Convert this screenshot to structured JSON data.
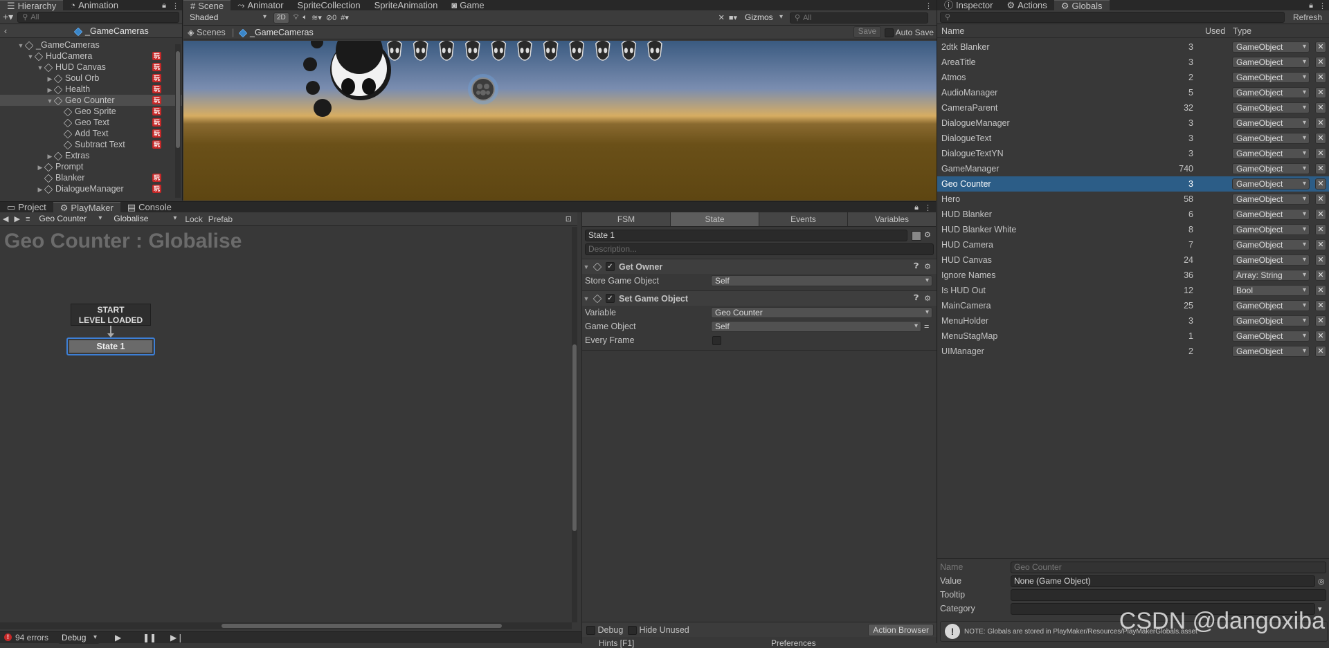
{
  "hierarchy": {
    "tabs": [
      "Hierarchy",
      "Animation"
    ],
    "search_placeholder": "All",
    "back_label": "_GameCameras",
    "items": [
      {
        "label": "_GameCameras",
        "depth": 0,
        "expanded": true,
        "pm": false
      },
      {
        "label": "HudCamera",
        "depth": 1,
        "expanded": true,
        "pm": true
      },
      {
        "label": "HUD Canvas",
        "depth": 2,
        "expanded": true,
        "pm": true
      },
      {
        "label": "Soul Orb",
        "depth": 3,
        "expanded": false,
        "pm": true
      },
      {
        "label": "Health",
        "depth": 3,
        "expanded": false,
        "pm": true
      },
      {
        "label": "Geo Counter",
        "depth": 3,
        "expanded": true,
        "pm": true,
        "selected": true
      },
      {
        "label": "Geo Sprite",
        "depth": 4,
        "expanded": null,
        "pm": true
      },
      {
        "label": "Geo Text",
        "depth": 4,
        "expanded": null,
        "pm": true
      },
      {
        "label": "Add Text",
        "depth": 4,
        "expanded": null,
        "pm": true
      },
      {
        "label": "Subtract Text",
        "depth": 4,
        "expanded": null,
        "pm": true
      },
      {
        "label": "Extras",
        "depth": 3,
        "expanded": false,
        "pm": false
      },
      {
        "label": "Prompt",
        "depth": 2,
        "expanded": false,
        "pm": false
      },
      {
        "label": "Blanker",
        "depth": 2,
        "expanded": null,
        "pm": true
      },
      {
        "label": "DialogueManager",
        "depth": 2,
        "expanded": false,
        "pm": true
      }
    ],
    "pm_badge": "玩"
  },
  "scene": {
    "tabs": [
      "Scene",
      "Animator",
      "SpriteCollection",
      "SpriteAnimation",
      "Game"
    ],
    "shading": "Shaded",
    "mode_2d": "2D",
    "fx_count": "0",
    "gizmos": "Gizmos",
    "search_placeholder": "All",
    "breadcrumb_scenes": "Scenes",
    "breadcrumb_prefab": "_GameCameras",
    "save_label": "Save",
    "autosave_label": "Auto Save"
  },
  "playmaker": {
    "tabs": [
      "Project",
      "PlayMaker",
      "Console"
    ],
    "fsm_target": "Geo Counter",
    "fsm_name": "Globalise",
    "lock_label": "Lock",
    "prefab_label": "Prefab",
    "graph_title": "Geo Counter : Globalise",
    "start_line1": "START",
    "start_line2": "LEVEL LOADED",
    "state_label": "State 1",
    "inspector_tabs": [
      "FSM",
      "State",
      "Events",
      "Variables"
    ],
    "state_name": "State 1",
    "description_placeholder": "Description...",
    "actions": [
      {
        "title": "Get Owner",
        "props": [
          {
            "label": "Store Game Object",
            "value": "Self"
          }
        ]
      },
      {
        "title": "Set Game Object",
        "props": [
          {
            "label": "Variable",
            "value": "Geo Counter"
          },
          {
            "label": "Game Object",
            "value": "Self"
          },
          {
            "label": "Every Frame",
            "value": ""
          }
        ]
      }
    ],
    "debug_label": "Debug",
    "hide_unused_label": "Hide Unused",
    "action_browser_label": "Action Browser",
    "hints_label": "Hints [F1]",
    "preferences_label": "Preferences"
  },
  "status": {
    "errors": "94 errors",
    "debug_mode": "Debug"
  },
  "globals": {
    "tabs": [
      "Inspector",
      "Actions",
      "Globals"
    ],
    "refresh_label": "Refresh",
    "columns": [
      "Name",
      "Used",
      "Type"
    ],
    "rows": [
      {
        "name": "2dtk Blanker",
        "used": "3",
        "type": "GameObject"
      },
      {
        "name": "AreaTitle",
        "used": "3",
        "type": "GameObject"
      },
      {
        "name": "Atmos",
        "used": "2",
        "type": "GameObject"
      },
      {
        "name": "AudioManager",
        "used": "5",
        "type": "GameObject"
      },
      {
        "name": "CameraParent",
        "used": "32",
        "type": "GameObject"
      },
      {
        "name": "DialogueManager",
        "used": "3",
        "type": "GameObject"
      },
      {
        "name": "DialogueText",
        "used": "3",
        "type": "GameObject"
      },
      {
        "name": "DialogueTextYN",
        "used": "3",
        "type": "GameObject"
      },
      {
        "name": "GameManager",
        "used": "740",
        "type": "GameObject"
      },
      {
        "name": "Geo Counter",
        "used": "3",
        "type": "GameObject",
        "selected": true
      },
      {
        "name": "Hero",
        "used": "58",
        "type": "GameObject"
      },
      {
        "name": "HUD Blanker",
        "used": "6",
        "type": "GameObject"
      },
      {
        "name": "HUD Blanker White",
        "used": "8",
        "type": "GameObject"
      },
      {
        "name": "HUD Camera",
        "used": "7",
        "type": "GameObject"
      },
      {
        "name": "HUD Canvas",
        "used": "24",
        "type": "GameObject"
      },
      {
        "name": "Ignore Names",
        "used": "36",
        "type": "Array: String"
      },
      {
        "name": "Is HUD Out",
        "used": "12",
        "type": "Bool"
      },
      {
        "name": "MainCamera",
        "used": "25",
        "type": "GameObject"
      },
      {
        "name": "MenuHolder",
        "used": "3",
        "type": "GameObject"
      },
      {
        "name": "MenuStagMap",
        "used": "1",
        "type": "GameObject"
      },
      {
        "name": "UIManager",
        "used": "2",
        "type": "GameObject"
      }
    ],
    "detail": {
      "name_label": "Name",
      "name_value": "Geo Counter",
      "value_label": "Value",
      "value_value": "None (Game Object)",
      "tooltip_label": "Tooltip",
      "category_label": "Category",
      "note": "NOTE: Globals are stored in PlayMaker/Resources/PlayMakerGlobals.asset"
    }
  },
  "watermark": "CSDN @dangoxiba",
  "colors": {
    "selection": "#2c5d87",
    "state_outline": "#3d7fd6",
    "error_red": "#c62828"
  }
}
